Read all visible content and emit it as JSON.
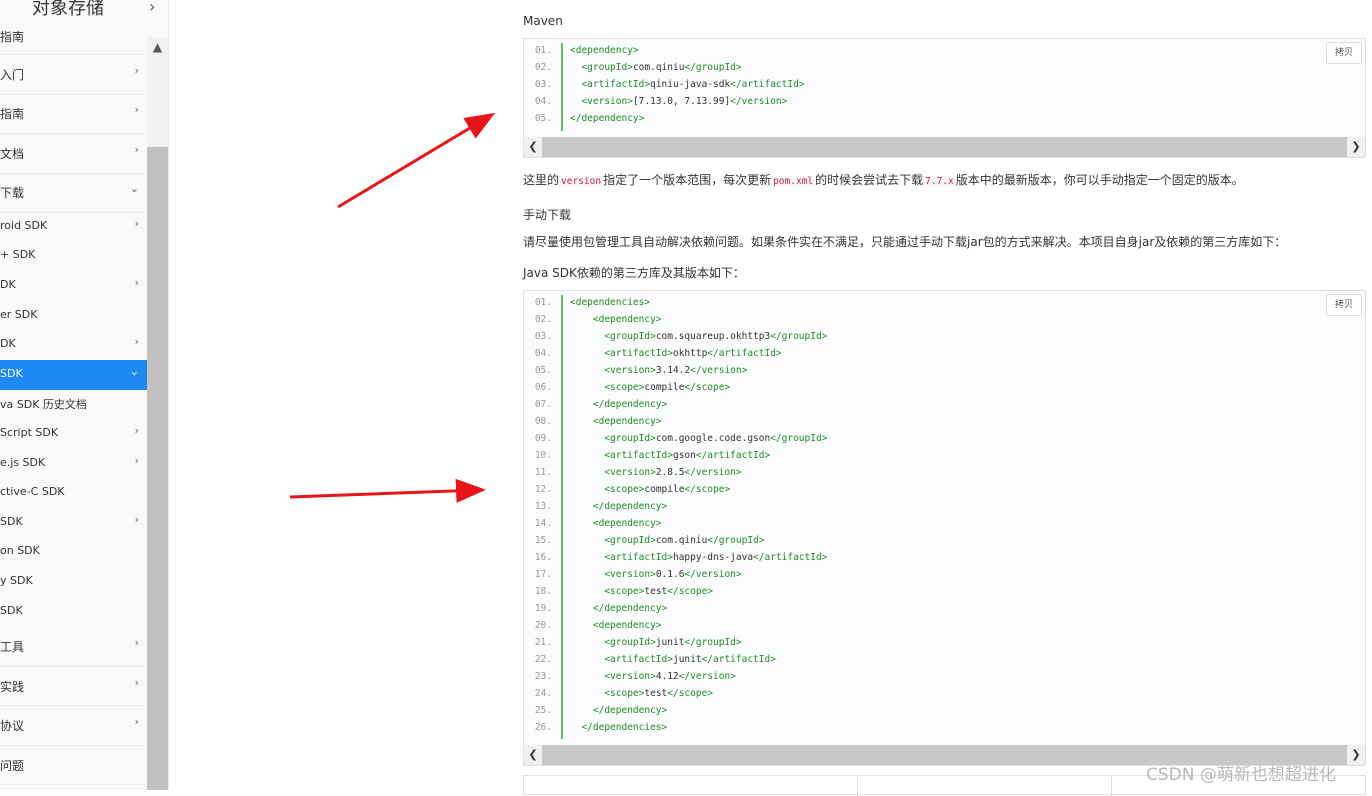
{
  "sidebar": {
    "title": "对象存储",
    "items": [
      {
        "label": "指南",
        "level": 1,
        "chev": ""
      },
      {
        "label": "入门",
        "level": 1,
        "chev": "›"
      },
      {
        "label": "指南",
        "level": 1,
        "chev": "›"
      },
      {
        "label": "文档",
        "level": 1,
        "chev": "›"
      },
      {
        "label": "下载",
        "level": 1,
        "chev": "⌄"
      },
      {
        "label": "roid SDK",
        "level": 2,
        "chev": "›"
      },
      {
        "label": "+ SDK",
        "level": 2,
        "chev": ""
      },
      {
        "label": "DK",
        "level": 2,
        "chev": "›"
      },
      {
        "label": "er SDK",
        "level": 2,
        "chev": ""
      },
      {
        "label": "DK",
        "level": 2,
        "chev": "›"
      },
      {
        "label": "SDK",
        "level": 2,
        "chev": "⌄",
        "active": true
      },
      {
        "label": "va SDK 历史文档",
        "level": 2,
        "chev": ""
      },
      {
        "label": "Script SDK",
        "level": 2,
        "chev": "›"
      },
      {
        "label": "e.js SDK",
        "level": 2,
        "chev": "›"
      },
      {
        "label": "ctive-C SDK",
        "level": 2,
        "chev": ""
      },
      {
        "label": "SDK",
        "level": 2,
        "chev": "›"
      },
      {
        "label": "on SDK",
        "level": 2,
        "chev": ""
      },
      {
        "label": "y SDK",
        "level": 2,
        "chev": ""
      },
      {
        "label": "SDK",
        "level": 2,
        "chev": ""
      },
      {
        "label": "工具",
        "level": 1,
        "chev": "›"
      },
      {
        "label": "实践",
        "level": 1,
        "chev": "›"
      },
      {
        "label": "协议",
        "level": 1,
        "chev": "›"
      },
      {
        "label": "问题",
        "level": 1,
        "chev": ""
      }
    ]
  },
  "content": {
    "maven_heading": "Maven",
    "copy_label": "拷贝",
    "code1": [
      {
        "n": "01.",
        "indent": "",
        "parts": [
          [
            "tag",
            "<dependency>"
          ]
        ]
      },
      {
        "n": "02.",
        "indent": "  ",
        "parts": [
          [
            "tag",
            "<groupId>"
          ],
          [
            "txt",
            "com.qiniu"
          ],
          [
            "tag",
            "</groupId>"
          ]
        ]
      },
      {
        "n": "03.",
        "indent": "  ",
        "parts": [
          [
            "tag",
            "<artifactId>"
          ],
          [
            "txt",
            "qiniu-java-sdk"
          ],
          [
            "tag",
            "</artifactId>"
          ]
        ]
      },
      {
        "n": "04.",
        "indent": "  ",
        "parts": [
          [
            "tag",
            "<version>"
          ],
          [
            "txt",
            "[7.13.0, 7.13.99]"
          ],
          [
            "tag",
            "</version>"
          ]
        ]
      },
      {
        "n": "05.",
        "indent": "",
        "parts": [
          [
            "tag",
            "</dependency>"
          ]
        ]
      }
    ],
    "para1_a": "这里的",
    "para1_code1": "version",
    "para1_b": "指定了一个版本范围，每次更新",
    "para1_code2": "pom.xml",
    "para1_c": "的时候会尝试去下载",
    "para1_code3": "7.7.x",
    "para1_d": "版本中的最新版本，你可以手动指定一个固定的版本。",
    "manual_heading": "手动下载",
    "para2": "请尽量使用包管理工具自动解决依赖问题。如果条件实在不满足，只能通过手动下载jar包的方式来解决。本项目自身jar及依赖的第三方库如下：",
    "para3": "Java SDK依赖的第三方库及其版本如下：",
    "code2": [
      {
        "n": "01.",
        "indent": "",
        "parts": [
          [
            "tag",
            "<dependencies>"
          ]
        ]
      },
      {
        "n": "02.",
        "indent": "    ",
        "parts": [
          [
            "tag",
            "<dependency>"
          ]
        ]
      },
      {
        "n": "03.",
        "indent": "      ",
        "parts": [
          [
            "tag",
            "<groupId>"
          ],
          [
            "txt",
            "com.squareup.okhttp3"
          ],
          [
            "tag",
            "</groupId>"
          ]
        ]
      },
      {
        "n": "04.",
        "indent": "      ",
        "parts": [
          [
            "tag",
            "<artifactId>"
          ],
          [
            "txt",
            "okhttp"
          ],
          [
            "tag",
            "</artifactId>"
          ]
        ]
      },
      {
        "n": "05.",
        "indent": "      ",
        "parts": [
          [
            "tag",
            "<version>"
          ],
          [
            "txt",
            "3.14.2"
          ],
          [
            "tag",
            "</version>"
          ]
        ]
      },
      {
        "n": "06.",
        "indent": "      ",
        "parts": [
          [
            "tag",
            "<scope>"
          ],
          [
            "txt",
            "compile"
          ],
          [
            "tag",
            "</scope>"
          ]
        ]
      },
      {
        "n": "07.",
        "indent": "    ",
        "parts": [
          [
            "tag",
            "</dependency>"
          ]
        ]
      },
      {
        "n": "08.",
        "indent": "    ",
        "parts": [
          [
            "tag",
            "<dependency>"
          ]
        ]
      },
      {
        "n": "09.",
        "indent": "      ",
        "parts": [
          [
            "tag",
            "<groupId>"
          ],
          [
            "txt",
            "com.google.code.gson"
          ],
          [
            "tag",
            "</groupId>"
          ]
        ]
      },
      {
        "n": "10.",
        "indent": "      ",
        "parts": [
          [
            "tag",
            "<artifactId>"
          ],
          [
            "txt",
            "gson"
          ],
          [
            "tag",
            "</artifactId>"
          ]
        ]
      },
      {
        "n": "11.",
        "indent": "      ",
        "parts": [
          [
            "tag",
            "<version>"
          ],
          [
            "txt",
            "2.8.5"
          ],
          [
            "tag",
            "</version>"
          ]
        ]
      },
      {
        "n": "12.",
        "indent": "      ",
        "parts": [
          [
            "tag",
            "<scope>"
          ],
          [
            "txt",
            "compile"
          ],
          [
            "tag",
            "</scope>"
          ]
        ]
      },
      {
        "n": "13.",
        "indent": "    ",
        "parts": [
          [
            "tag",
            "</dependency>"
          ]
        ]
      },
      {
        "n": "14.",
        "indent": "    ",
        "parts": [
          [
            "tag",
            "<dependency>"
          ]
        ]
      },
      {
        "n": "15.",
        "indent": "      ",
        "parts": [
          [
            "tag",
            "<groupId>"
          ],
          [
            "txt",
            "com.qiniu"
          ],
          [
            "tag",
            "</groupId>"
          ]
        ]
      },
      {
        "n": "16.",
        "indent": "      ",
        "parts": [
          [
            "tag",
            "<artifactId>"
          ],
          [
            "txt",
            "happy-dns-java"
          ],
          [
            "tag",
            "</artifactId>"
          ]
        ]
      },
      {
        "n": "17.",
        "indent": "      ",
        "parts": [
          [
            "tag",
            "<version>"
          ],
          [
            "txt",
            "0.1.6"
          ],
          [
            "tag",
            "</version>"
          ]
        ]
      },
      {
        "n": "18.",
        "indent": "      ",
        "parts": [
          [
            "tag",
            "<scope>"
          ],
          [
            "txt",
            "test"
          ],
          [
            "tag",
            "</scope>"
          ]
        ]
      },
      {
        "n": "19.",
        "indent": "    ",
        "parts": [
          [
            "tag",
            "</dependency>"
          ]
        ]
      },
      {
        "n": "20.",
        "indent": "    ",
        "parts": [
          [
            "tag",
            "<dependency>"
          ]
        ]
      },
      {
        "n": "21.",
        "indent": "      ",
        "parts": [
          [
            "tag",
            "<groupId>"
          ],
          [
            "txt",
            "junit"
          ],
          [
            "tag",
            "</groupId>"
          ]
        ]
      },
      {
        "n": "22.",
        "indent": "      ",
        "parts": [
          [
            "tag",
            "<artifactId>"
          ],
          [
            "txt",
            "junit"
          ],
          [
            "tag",
            "</artifactId>"
          ]
        ]
      },
      {
        "n": "23.",
        "indent": "      ",
        "parts": [
          [
            "tag",
            "<version>"
          ],
          [
            "txt",
            "4.12"
          ],
          [
            "tag",
            "</version>"
          ]
        ]
      },
      {
        "n": "24.",
        "indent": "      ",
        "parts": [
          [
            "tag",
            "<scope>"
          ],
          [
            "txt",
            "test"
          ],
          [
            "tag",
            "</scope>"
          ]
        ]
      },
      {
        "n": "25.",
        "indent": "    ",
        "parts": [
          [
            "tag",
            "</dependency>"
          ]
        ]
      },
      {
        "n": "26.",
        "indent": "  ",
        "parts": [
          [
            "tag",
            "</dependencies>"
          ]
        ]
      }
    ]
  },
  "watermark": "CSDN @萌新也想超进化",
  "colors": {
    "accent": "#1e88f5",
    "annotation": "#e8141a",
    "tag": "#228b22"
  }
}
